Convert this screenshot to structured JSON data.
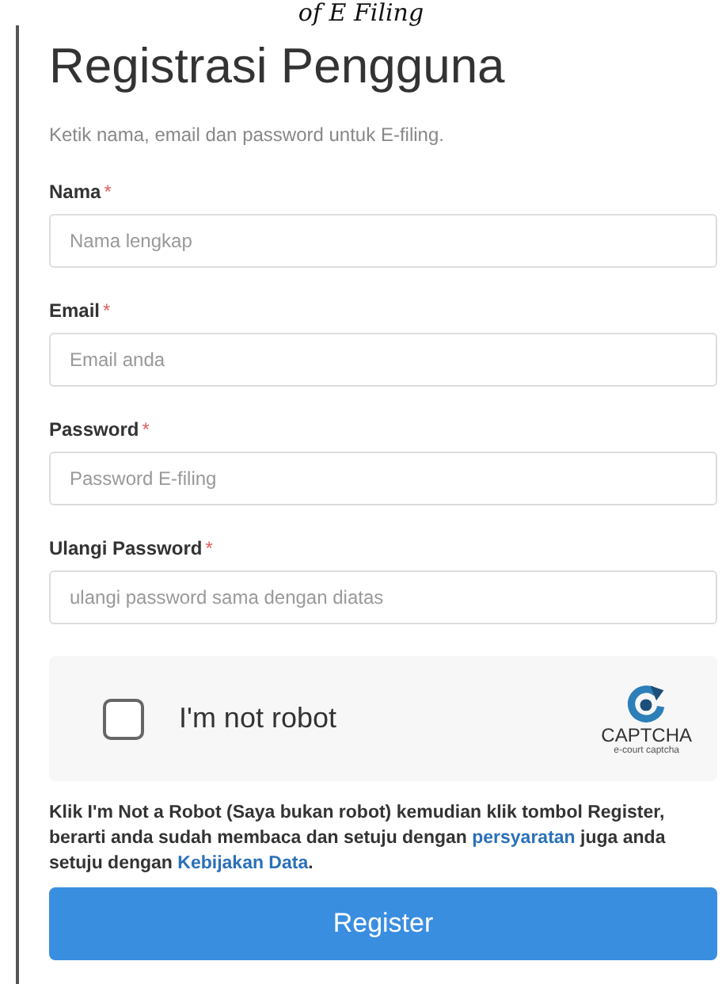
{
  "caption": "of E Filing",
  "title": "Registrasi Pengguna",
  "subtitle": "Ketik nama, email dan password untuk E-filing.",
  "fields": [
    {
      "label": "Nama",
      "required_mark": "*",
      "placeholder": "Nama lengkap"
    },
    {
      "label": "Email",
      "required_mark": "*",
      "placeholder": "Email anda"
    },
    {
      "label": "Password",
      "required_mark": "*",
      "placeholder": "Password E-filing"
    },
    {
      "label": "Ulangi Password",
      "required_mark": "*",
      "placeholder": "ulangi password sama dengan diatas"
    }
  ],
  "captcha": {
    "label": "I'm not robot",
    "checked": false,
    "logo_text": "CAPTCHA",
    "logo_subtext": "e-court captcha"
  },
  "notice": [
    {
      "kind": "text",
      "text": "Klik I'm Not a Robot (Saya bukan robot) kemudian klik tombol Register, berarti anda sudah membaca dan setuju dengan "
    },
    {
      "kind": "link",
      "text": "persyaratan"
    },
    {
      "kind": "text",
      "text": " juga anda setuju dengan "
    },
    {
      "kind": "link",
      "text": "Kebijakan Data"
    },
    {
      "kind": "text",
      "text": "."
    }
  ],
  "button": "Register"
}
